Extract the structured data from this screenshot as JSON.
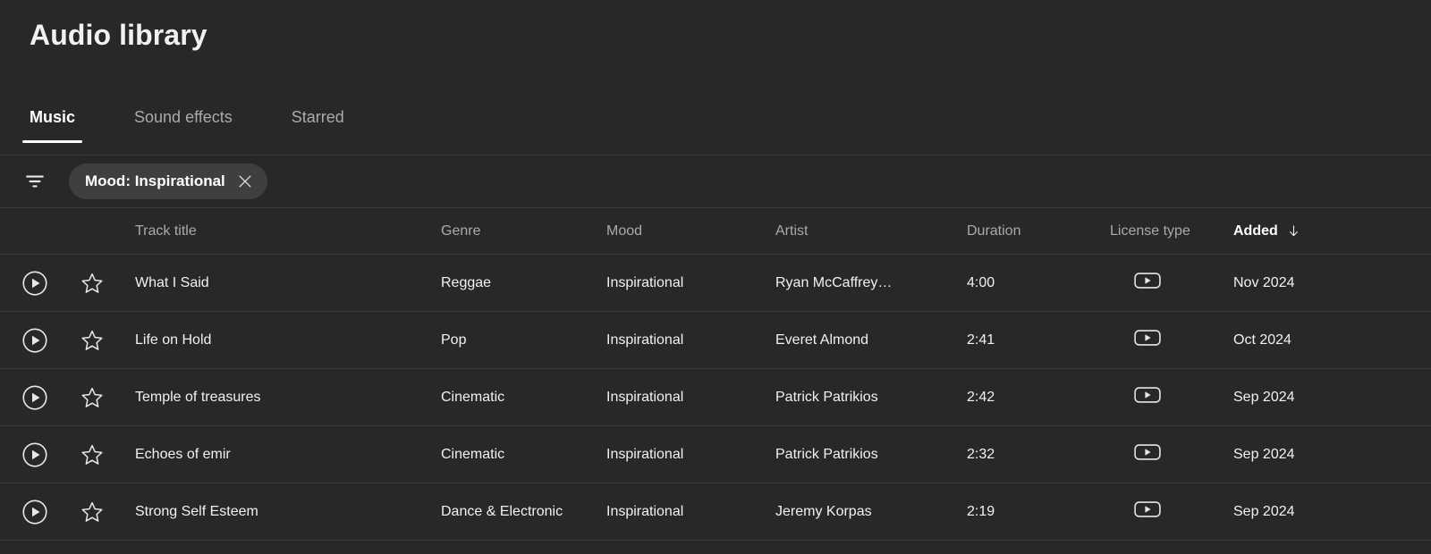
{
  "page": {
    "title": "Audio library",
    "background_color": "#282828",
    "accent_color": "#ffffff",
    "divider_color": "#3a3a3a",
    "chip_background_color": "#3f3f3f",
    "muted_text_color": "#aaaaaa",
    "text_color": "#f1f1f1"
  },
  "tabs": [
    {
      "label": "Music",
      "active": true
    },
    {
      "label": "Sound effects",
      "active": false
    },
    {
      "label": "Starred",
      "active": false
    }
  ],
  "filter_bar": {
    "filter_icon": "filter-list-icon",
    "chips": [
      {
        "label": "Mood: Inspirational",
        "close_icon": "close-icon"
      }
    ]
  },
  "table": {
    "columns": [
      {
        "key": "title",
        "label": "Track title",
        "sorted": false
      },
      {
        "key": "genre",
        "label": "Genre",
        "sorted": false
      },
      {
        "key": "mood",
        "label": "Mood",
        "sorted": false
      },
      {
        "key": "artist",
        "label": "Artist",
        "sorted": false
      },
      {
        "key": "duration",
        "label": "Duration",
        "sorted": false
      },
      {
        "key": "license",
        "label": "License type",
        "sorted": false
      },
      {
        "key": "added",
        "label": "Added",
        "sorted": true,
        "sort_direction": "descending",
        "sort_icon": "arrow-down-icon"
      }
    ],
    "row_icons": {
      "play": "play-circle-icon",
      "star": "star-outline-icon",
      "license": "youtube-icon"
    },
    "rows": [
      {
        "title": "What I Said",
        "genre": "Reggae",
        "mood": "Inspirational",
        "artist": "Ryan McCaffrey…",
        "duration": "4:00",
        "license": "youtube-icon",
        "added": "Nov 2024"
      },
      {
        "title": "Life on Hold",
        "genre": "Pop",
        "mood": "Inspirational",
        "artist": "Everet Almond",
        "duration": "2:41",
        "license": "youtube-icon",
        "added": "Oct 2024"
      },
      {
        "title": "Temple of treasures",
        "genre": "Cinematic",
        "mood": "Inspirational",
        "artist": "Patrick Patrikios",
        "duration": "2:42",
        "license": "youtube-icon",
        "added": "Sep 2024"
      },
      {
        "title": "Echoes of emir",
        "genre": "Cinematic",
        "mood": "Inspirational",
        "artist": "Patrick Patrikios",
        "duration": "2:32",
        "license": "youtube-icon",
        "added": "Sep 2024"
      },
      {
        "title": "Strong Self Esteem",
        "genre": "Dance & Electronic",
        "mood": "Inspirational",
        "artist": "Jeremy Korpas",
        "duration": "2:19",
        "license": "youtube-icon",
        "added": "Sep 2024"
      }
    ]
  }
}
